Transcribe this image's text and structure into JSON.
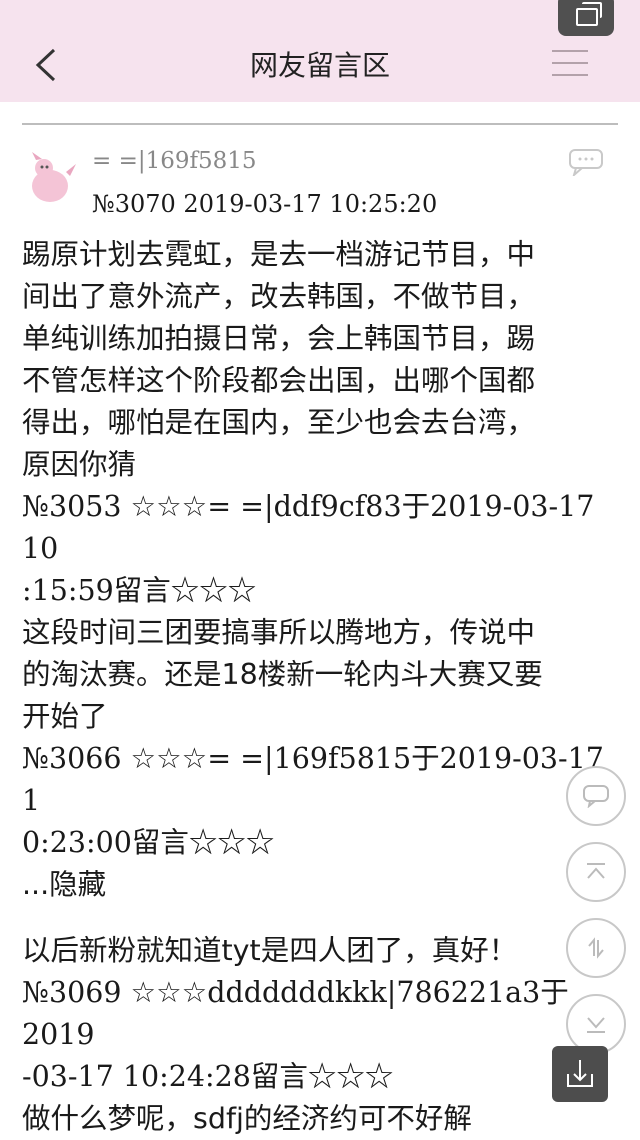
{
  "header": {
    "title": "网友留言区"
  },
  "post": {
    "username": "= =|169f5815",
    "meta": "№3070   2019-03-17 10:25:20"
  },
  "content_lines": [
    "踢原计划去霓虹，是去一档游记节目，中",
    "间出了意外流产，改去韩国，不做节目，",
    "单纯训练加拍摄日常，会上韩国节目，踢",
    "不管怎样这个阶段都会出国，出哪个国都",
    "得出，哪怕是在国内，至少也会去台湾，",
    "原因你猜",
    "№3053 ☆☆☆= =|ddf9cf83于2019-03-17 10",
    ":15:59留言☆☆☆",
    "这段时间三团要搞事所以腾地方，传说中",
    "的淘汰赛。还是18楼新一轮内斗大赛又要",
    "开始了",
    "№3066 ☆☆☆= =|169f5815于2019-03-17 1",
    "0:23:00留言☆☆☆",
    "...隐藏",
    "",
    "以后新粉就知道tyt是四人团了，真好！",
    "№3069 ☆☆☆dddddddkkk|786221a3于2019",
    "-03-17 10:24:28留言☆☆☆",
    "做什么梦呢，sdfj的经济约可不好解"
  ]
}
